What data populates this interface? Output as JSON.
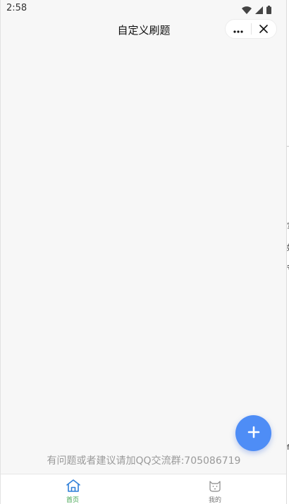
{
  "status_bar": {
    "time": "2:58"
  },
  "nav": {
    "title": "自定义刷题"
  },
  "footer": {
    "notice": "有问题或者建议请加QQ交流群:705086719"
  },
  "tabs": [
    {
      "label": "首页",
      "icon": "home-icon",
      "active": true
    },
    {
      "label": "我的",
      "icon": "cat-face-icon",
      "active": false
    }
  ],
  "colors": {
    "accent": "#4e8df6",
    "tab_active": "#3fa34d",
    "background": "#f7f7f7"
  },
  "edge_glyphs": [
    "军",
    "好",
    "守",
    "f"
  ]
}
